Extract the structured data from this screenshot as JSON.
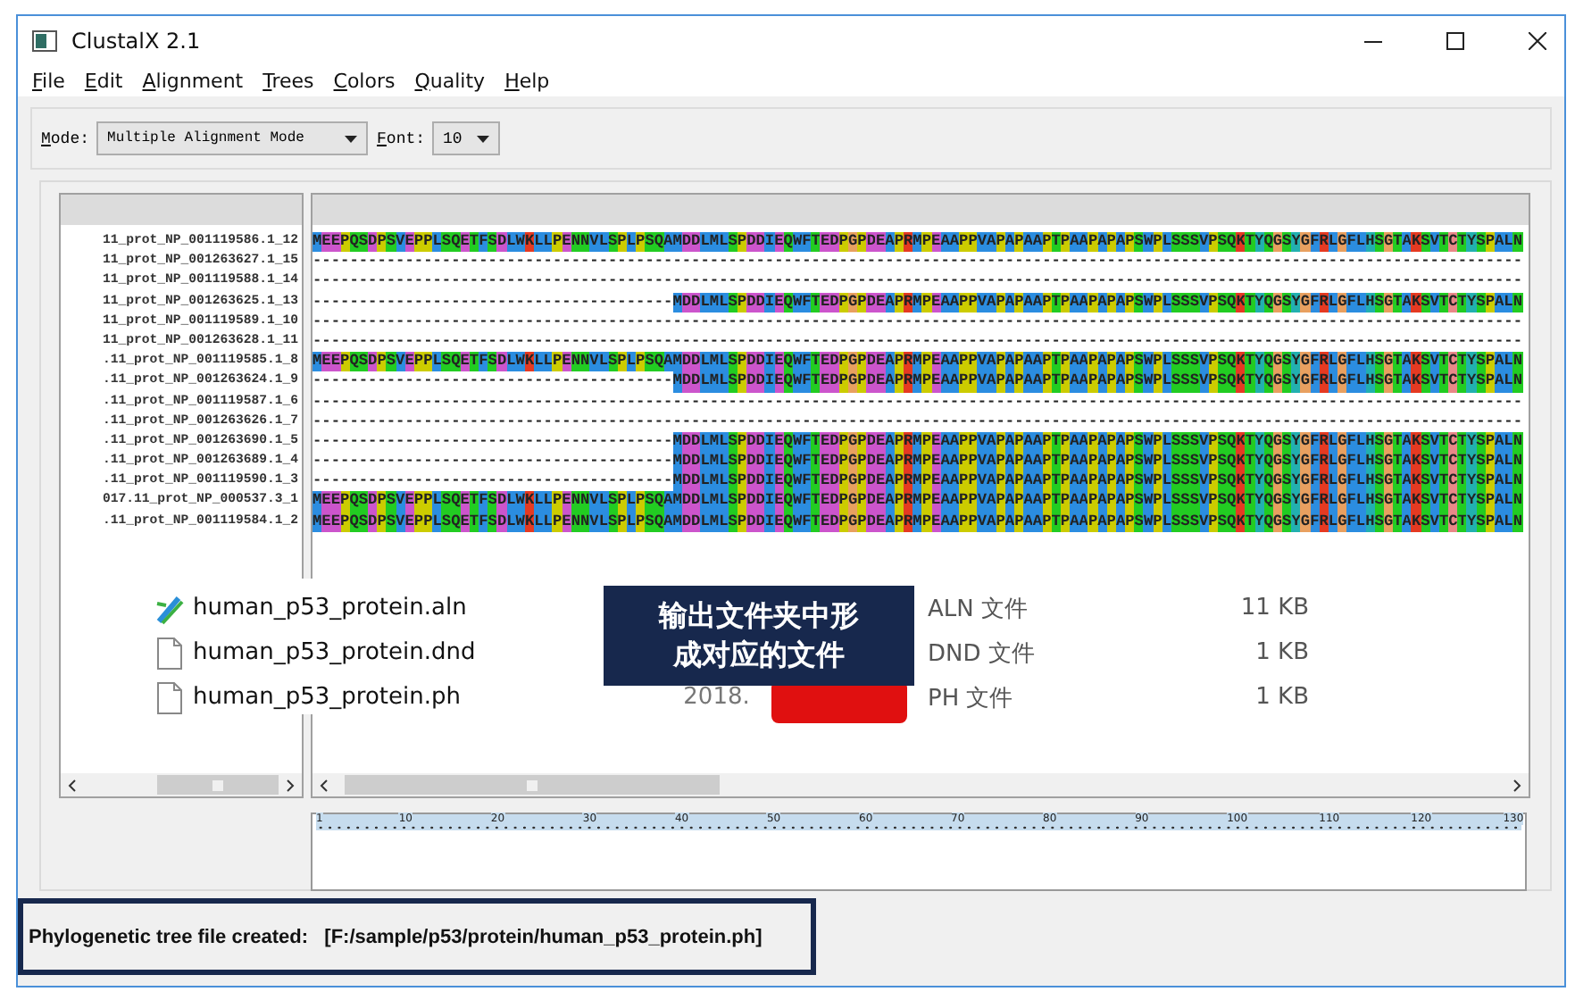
{
  "window": {
    "title": "ClustalX 2.1"
  },
  "menu": [
    {
      "label": "File"
    },
    {
      "label": "Edit"
    },
    {
      "label": "Alignment"
    },
    {
      "label": "Trees"
    },
    {
      "label": "Colors"
    },
    {
      "label": "Quality"
    },
    {
      "label": "Help"
    }
  ],
  "toolbar": {
    "mode_label": "Mode:",
    "mode_value": "Multiple Alignment Mode",
    "font_label": "Font:",
    "font_value": "10"
  },
  "sequences": [
    {
      "name": "11_prot_NP_001119586.1_12",
      "residues": "MEEPQSDPSVEPPLSQETFSDLWKLLPENNVLSPLPSQAMDDLMLSPDDIEQWFTEDPGPDEAPRMPEAAPPVAPAPAAPTPAAPAPAPSWPLSSSVPSQKTYQGSYGFRLGFLHSGTAKSVTCTYSPALN"
    },
    {
      "name": "11_prot_NP_001263627.1_15",
      "residues": "-----------------------------------------------------------------------------------------------------------------------------------"
    },
    {
      "name": "11_prot_NP_001119588.1_14",
      "residues": "-----------------------------------------------------------------------------------------------------------------------------------"
    },
    {
      "name": "11_prot_NP_001263625.1_13",
      "residues": "---------------------------------------MDDLMLSPDDIEQWFTEDPGPDEAPRMPEAAPPVAPAPAAPTPAAPAPAPSWPLSSSVPSQKTYQGSYGFRLGFLHSGTAKSVTCTYSPALN"
    },
    {
      "name": "11_prot_NP_001119589.1_10",
      "residues": "-----------------------------------------------------------------------------------------------------------------------------------"
    },
    {
      "name": "11_prot_NP_001263628.1_11",
      "residues": "-----------------------------------------------------------------------------------------------------------------------------------"
    },
    {
      "name": ".11_prot_NP_001119585.1_8",
      "residues": "MEEPQSDPSVEPPLSQETFSDLWKLLPENNVLSPLPSQAMDDLMLSPDDIEQWFTEDPGPDEAPRMPEAAPPVAPAPAAPTPAAPAPAPSWPLSSSVPSQKTYQGSYGFRLGFLHSGTAKSVTCTYSPALN"
    },
    {
      "name": ".11_prot_NP_001263624.1_9",
      "residues": "---------------------------------------MDDLMLSPDDIEQWFTEDPGPDEAPRMPEAAPPVAPAPAAPTPAAPAPAPSWPLSSSVPSQKTYQGSYGFRLGFLHSGTAKSVTCTYSPALN"
    },
    {
      "name": ".11_prot_NP_001119587.1_6",
      "residues": "-----------------------------------------------------------------------------------------------------------------------------------"
    },
    {
      "name": ".11_prot_NP_001263626.1_7",
      "residues": "-----------------------------------------------------------------------------------------------------------------------------------"
    },
    {
      "name": ".11_prot_NP_001263690.1_5",
      "residues": "---------------------------------------MDDLMLSPDDIEQWFTEDPGPDEAPRMPEAAPPVAPAPAAPTPAAPAPAPSWPLSSSVPSQKTYQGSYGFRLGFLHSGTAKSVTCTYSPALN"
    },
    {
      "name": ".11_prot_NP_001263689.1_4",
      "residues": "---------------------------------------MDDLMLSPDDIEQWFTEDPGPDEAPRMPEAAPPVAPAPAAPTPAAPAPAPSWPLSSSVPSQKTYQGSYGFRLGFLHSGTAKSVTCTYSPALN"
    },
    {
      "name": ".11_prot_NP_001119590.1_3",
      "residues": "---------------------------------------MDDLMLSPDDIEQWFTEDPGPDEAPRMPEAAPPVAPAPAAPTPAAPAPAPSWPLSSSVPSQKTYQGSYGFRLGFLHSGTAKSVTCTYSPALN"
    },
    {
      "name": "017.11_prot_NP_000537.3_1",
      "residues": "MEEPQSDPSVEPPLSQETFSDLWKLLPENNVLSPLPSQAMDDLMLSPDDIEQWFTEDPGPDEAPRMPEAAPPVAPAPAAPTPAAPAPAPSWPLSSSVPSQKTYQGSYGFRLGFLHSGTAKSVTCTYSPALN"
    },
    {
      "name": ".11_prot_NP_001119584.1_2",
      "residues": "MEEPQSDPSVEPPLSQETFSDLWKLLPENNVLSPLPSQAMDDLMLSPDDIEQWFTEDPGPDEAPRMPEAAPPVAPAPAAPTPAAPAPAPSWPLSSSVPSQKTYQGSYGFRLGFLHSGTAKSVTCTYSPALN"
    }
  ],
  "ruler": {
    "labels": [
      "1",
      "10",
      "20",
      "30",
      "40",
      "50",
      "60",
      "70",
      "80",
      "90",
      "100",
      "110",
      "120",
      "130"
    ]
  },
  "file_list": [
    {
      "kind": "alignment",
      "name": "human_p53_protein.aln",
      "type": "ALN 文件",
      "size": "11 KB"
    },
    {
      "kind": "file",
      "name": "human_p53_protein.dnd",
      "type": "DND 文件",
      "size": "1 KB"
    },
    {
      "kind": "file",
      "name": "human_p53_protein.ph",
      "date": "2018.",
      "type": "PH 文件",
      "size": "1 KB"
    }
  ],
  "callout": "输出文件夹中形成对应的文件",
  "status": "Phylogenetic tree file created:   [F:/sample/p53/protein/human_p53_protein.ph]"
}
